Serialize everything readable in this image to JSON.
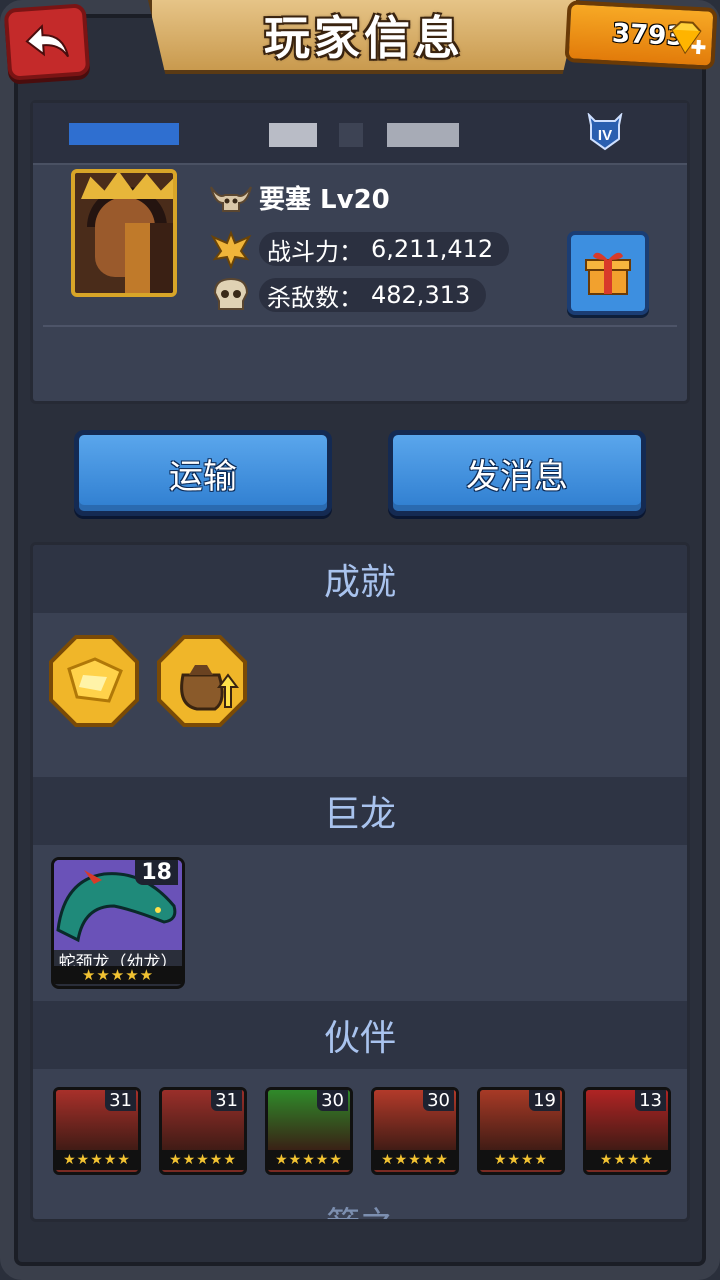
{
  "header": {
    "title": "玩家信息",
    "gems": "3793"
  },
  "player": {
    "rank_badge": "IV",
    "fortress_label": "要塞 Lv20",
    "power_label": "战斗力：",
    "power_value": "6,211,412",
    "kills_label": "杀敌数：",
    "kills_value": "482,313"
  },
  "actions": {
    "transport": "运输",
    "message": "发消息"
  },
  "sections": {
    "achievements": "成就",
    "dragons": "巨龙",
    "partners": "伙伴",
    "next_peek": "箭之"
  },
  "dragons": [
    {
      "level": "18",
      "name": "蛇颈龙（幼龙）",
      "stars": "★★★★★"
    }
  ],
  "partners": [
    {
      "level": "31",
      "stars": "★★★★★",
      "color": "#a8302a"
    },
    {
      "level": "31",
      "stars": "★★★★★",
      "color": "#9a2f2a"
    },
    {
      "level": "30",
      "stars": "★★★★★",
      "color": "#2f8a2a"
    },
    {
      "level": "30",
      "stars": "★★★★★",
      "color": "#b33a2a"
    },
    {
      "level": "19",
      "stars": "★★★★",
      "color": "#a83a26"
    },
    {
      "level": "13",
      "stars": "★★★★",
      "color": "#b02424"
    }
  ]
}
